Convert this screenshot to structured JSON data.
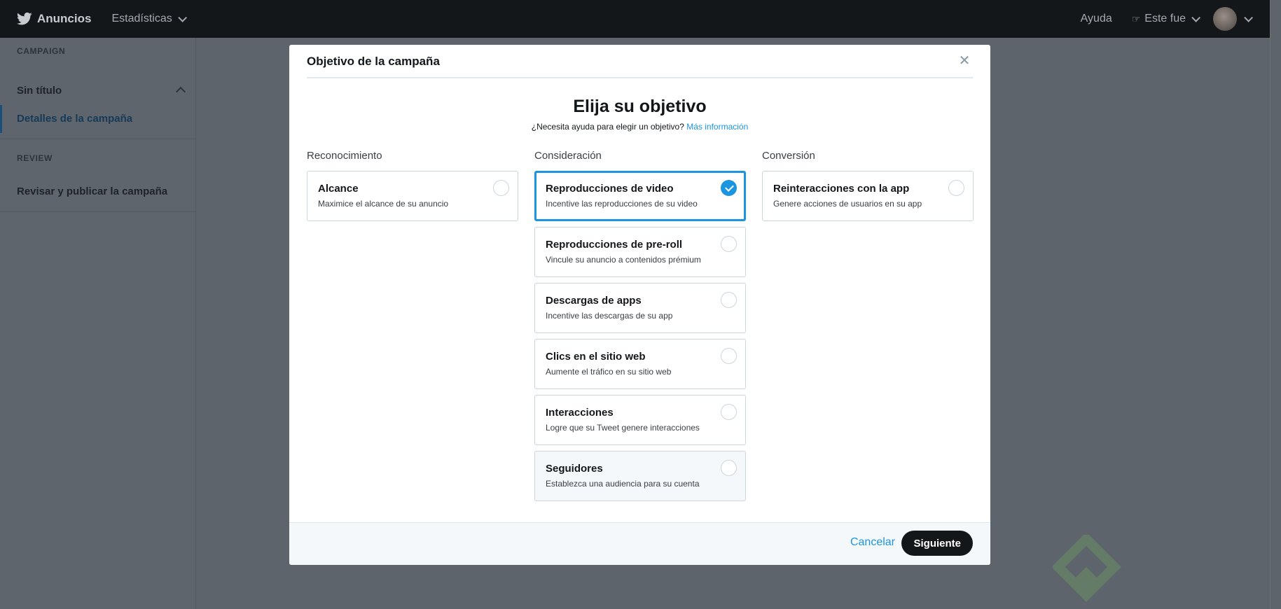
{
  "topbar": {
    "brand": "Anuncios",
    "stats_menu": "Estadísticas",
    "help": "Ayuda",
    "account_name": "Este fue"
  },
  "sidebar": {
    "campaign_section": "CAMPAIGN",
    "campaign_name": "Sin título",
    "campaign_details": "Detalles de la campaña",
    "review_section": "REVIEW",
    "review_item": "Revisar y publicar la campaña"
  },
  "modal": {
    "title": "Objetivo de la campaña",
    "heading": "Elija su objetivo",
    "help_text": "¿Necesita ayuda para elegir un objetivo?",
    "help_link": "Más información",
    "columns": [
      {
        "title": "Reconocimiento",
        "options": [
          {
            "title": "Alcance",
            "desc": "Maximice el alcance de su anuncio",
            "selected": false
          }
        ]
      },
      {
        "title": "Consideración",
        "options": [
          {
            "title": "Reproducciones de video",
            "desc": "Incentive las reproducciones de su video",
            "selected": true
          },
          {
            "title": "Reproducciones de pre-roll",
            "desc": "Vincule su anuncio a contenidos prémium",
            "selected": false
          },
          {
            "title": "Descargas de apps",
            "desc": "Incentive las descargas de su app",
            "selected": false
          },
          {
            "title": "Clics en el sitio web",
            "desc": "Aumente el tráfico en su sitio web",
            "selected": false
          },
          {
            "title": "Interacciones",
            "desc": "Logre que su Tweet genere interacciones",
            "selected": false
          },
          {
            "title": "Seguidores",
            "desc": "Establezca una audiencia para su cuenta",
            "selected": false
          }
        ]
      },
      {
        "title": "Conversión",
        "options": [
          {
            "title": "Reinteracciones con la app",
            "desc": "Genere acciones de usuarios en su app",
            "selected": false
          }
        ]
      }
    ],
    "cancel_label": "Cancelar",
    "next_label": "Siguiente"
  },
  "colors": {
    "accent": "#1b95e0",
    "topbar": "#14171a",
    "overlay": "#5d646c"
  }
}
